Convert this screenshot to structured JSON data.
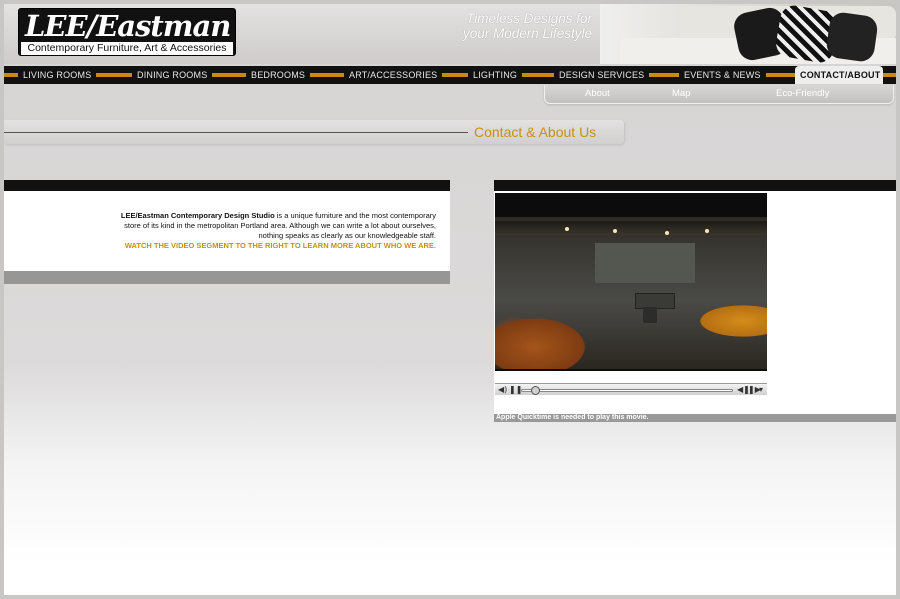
{
  "brand": {
    "logo_text": "LEE/Eastman",
    "logo_subtitle": "Contemporary Furniture, Art & Accessories",
    "tagline_line1": "Timeless Designs for",
    "tagline_line2": "your Modern Lifestyle"
  },
  "nav": {
    "items": [
      {
        "label": "LIVING ROOMS"
      },
      {
        "label": "DINING ROOMS"
      },
      {
        "label": "BEDROOMS"
      },
      {
        "label": "ART/ACCESSORIES"
      },
      {
        "label": "LIGHTING"
      },
      {
        "label": "DESIGN SERVICES"
      },
      {
        "label": "EVENTS & NEWS"
      },
      {
        "label": "CONTACT/ABOUT"
      }
    ],
    "active": "CONTACT/ABOUT"
  },
  "subnav": {
    "items": [
      {
        "label": "About"
      },
      {
        "label": "Map"
      },
      {
        "label": "Eco-Friendly"
      }
    ]
  },
  "page": {
    "title": "Contact & About Us"
  },
  "intro": {
    "strong": "LEE/Eastman Contemporary Design Studio",
    "text": " is a unique furniture and the most contemporary store of its kind in the metropolitan Portland area. Although we can write a lot about ourselves, nothing speaks as clearly as our knowledgeable staff.",
    "cta": "WATCH THE VIDEO SEGMENT TO THE RIGHT TO LEARN MORE ABOUT WHO WE ARE."
  },
  "video": {
    "note": "Apple Quicktime is needed to play this movie."
  },
  "colors": {
    "accent": "#c8900f",
    "nav_bg": "#111111",
    "nav_stripe": "#c88a12"
  }
}
